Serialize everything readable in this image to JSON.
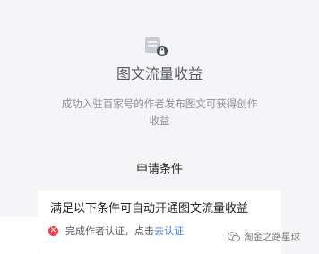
{
  "header": {
    "icon": "document-lock-icon",
    "title": "图文流量收益",
    "description": "成功入驻百家号的作者发布图文可获得创作收益"
  },
  "conditions": {
    "heading": "申请条件",
    "card_title": "满足以下条件可自动开通图文流量收益",
    "items": [
      {
        "status": "failed",
        "status_icon": "error-circle-icon",
        "text": "完成作者认证，点击",
        "link": "去认证"
      }
    ]
  },
  "watermark": {
    "icon": "wechat-icon",
    "text": "淘金之路星球"
  },
  "colors": {
    "background": "#f5f5f7",
    "card": "#ffffff",
    "error": "#e8424d",
    "link": "#3a7be0"
  }
}
